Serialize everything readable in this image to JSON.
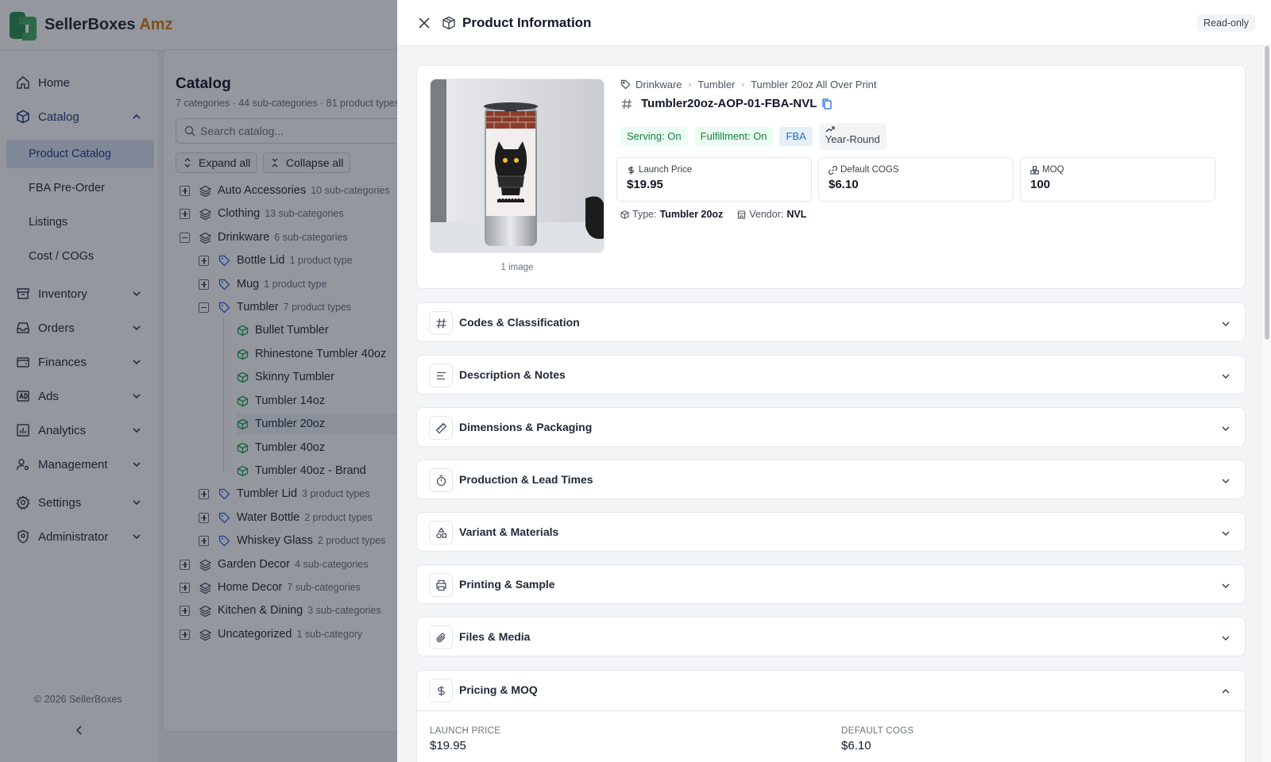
{
  "app": {
    "brand": "SellerBoxes",
    "brand_suffix": "Amz",
    "copyright": "© 2026 SellerBoxes"
  },
  "nav": {
    "home": "Home",
    "catalog": "Catalog",
    "catalog_items": [
      "Product Catalog",
      "FBA Pre-Order",
      "Listings",
      "Cost / COGs"
    ],
    "inventory": "Inventory",
    "orders": "Orders",
    "finances": "Finances",
    "ads": "Ads",
    "analytics": "Analytics",
    "management": "Management",
    "settings": "Settings",
    "administrator": "Administrator"
  },
  "catalog": {
    "title": "Catalog",
    "summary": "7 categories · 44 sub-categories · 81 product types",
    "search_placeholder": "Search catalog...",
    "expand_all": "Expand all",
    "collapse_all": "Collapse all",
    "tree": {
      "auto": {
        "name": "Auto Accessories",
        "count": "10 sub-categories"
      },
      "clothing": {
        "name": "Clothing",
        "count": "13 sub-categories"
      },
      "drinkware": {
        "name": "Drinkware",
        "count": "6 sub-categories"
      },
      "bottle_lid": {
        "name": "Bottle Lid",
        "count": "1 product type"
      },
      "mug": {
        "name": "Mug",
        "count": "1 product type"
      },
      "tumbler": {
        "name": "Tumbler",
        "count": "7 product types"
      },
      "tumbler_types": [
        "Bullet Tumbler",
        "Rhinestone Tumbler 40oz",
        "Skinny Tumbler",
        "Tumbler 14oz",
        "Tumbler 20oz",
        "Tumbler 40oz",
        "Tumbler 40oz - Brand"
      ],
      "tumbler_lid": {
        "name": "Tumbler Lid",
        "count": "3 product types"
      },
      "water_bottle": {
        "name": "Water Bottle",
        "count": "2 product types"
      },
      "whiskey_glass": {
        "name": "Whiskey Glass",
        "count": "2 product types"
      },
      "garden": {
        "name": "Garden Decor",
        "count": "4 sub-categories"
      },
      "home_decor": {
        "name": "Home Decor",
        "count": "7 sub-categories"
      },
      "kitchen": {
        "name": "Kitchen & Dining",
        "count": "3 sub-categories"
      },
      "uncategorized": {
        "name": "Uncategorized",
        "count": "1 sub-category"
      }
    }
  },
  "drawer": {
    "title": "Product Information",
    "mode_badge": "Read-only",
    "image_count": "1 image",
    "breadcrumb": [
      "Drinkware",
      "Tumbler",
      "Tumbler 20oz All Over Print"
    ],
    "sku": "Tumbler20oz-AOP-01-FBA-NVL",
    "badges": {
      "serving": "Serving: On",
      "fulfillment": "Fulfillment: On",
      "channel": "FBA",
      "season": "Year-Round"
    },
    "metrics": [
      {
        "label": "Launch Price",
        "value": "$19.95"
      },
      {
        "label": "Default COGS",
        "value": "$6.10"
      },
      {
        "label": "MOQ",
        "value": "100"
      }
    ],
    "type_label": "Type:",
    "type_value": "Tumbler 20oz",
    "vendor_label": "Vendor:",
    "vendor_value": "NVL",
    "sections": [
      "Codes & Classification",
      "Description & Notes",
      "Dimensions & Packaging",
      "Production & Lead Times",
      "Variant & Materials",
      "Printing & Sample",
      "Files & Media",
      "Pricing & MOQ"
    ],
    "pricing": {
      "launch_price_label": "LAUNCH PRICE",
      "launch_price_value": "$19.95",
      "default_cogs_label": "DEFAULT COGS",
      "default_cogs_value": "$6.10"
    }
  },
  "colors": {
    "accent": "#1e3a8a",
    "brand_orange": "#e07b12",
    "brand_green": "#2f8f4e",
    "tree_green": "#16a34a",
    "tree_blue": "#2563eb"
  }
}
